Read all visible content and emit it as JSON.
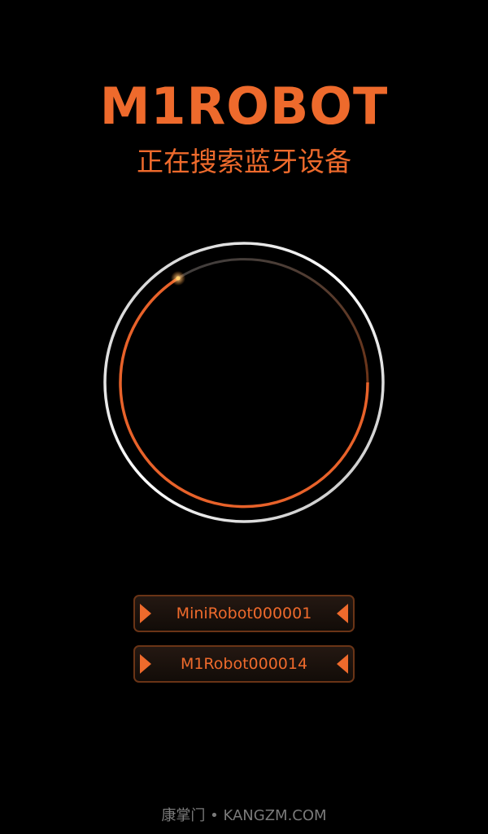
{
  "header": {
    "logo_text": "M1ROBOT",
    "status_text": "正在搜索蓝牙设备"
  },
  "scanner": {
    "icon": "bluetooth-scan-radar",
    "accent_color": "#ee6a2c",
    "ring_color": "#d8d8d8"
  },
  "devices": [
    {
      "name": "MiniRobot000001"
    },
    {
      "name": "M1Robot000014"
    }
  ],
  "footer": {
    "watermark": "康掌门 • KANGZM.COM"
  }
}
